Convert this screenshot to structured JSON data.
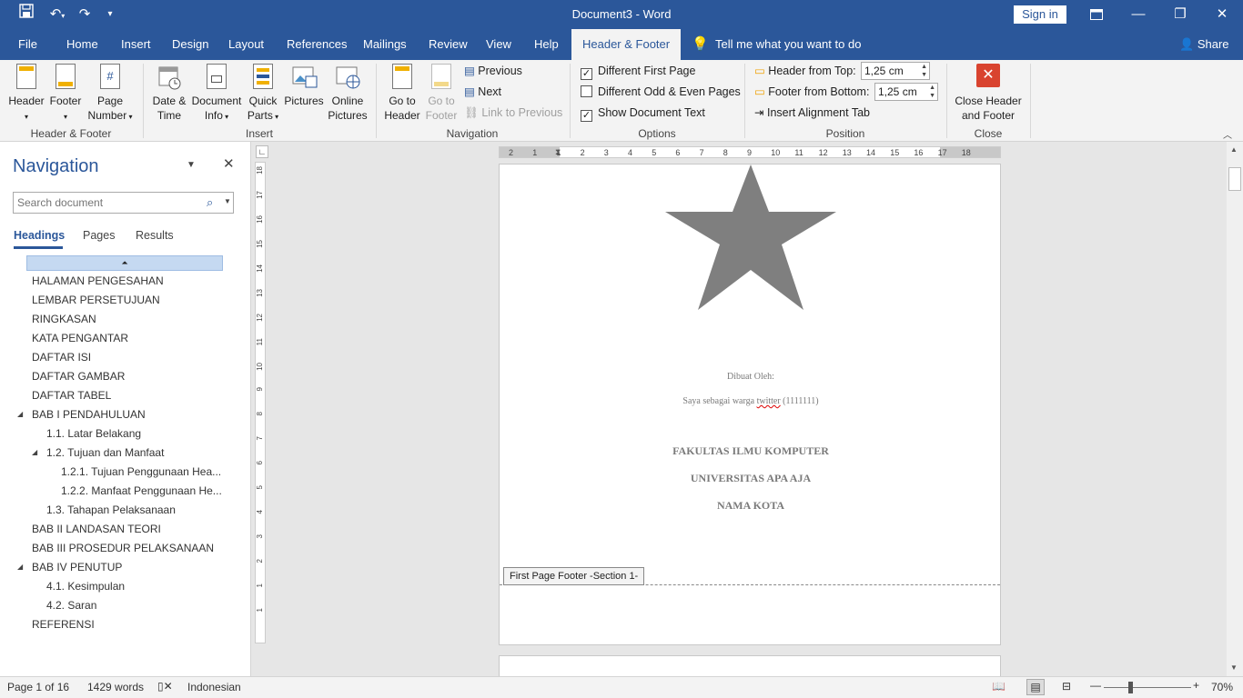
{
  "title": "Document3  -  Word",
  "sign_in": "Sign in",
  "tabs": [
    "File",
    "Home",
    "Insert",
    "Design",
    "Layout",
    "References",
    "Mailings",
    "Review",
    "View",
    "Help",
    "Header & Footer"
  ],
  "tell_me": "Tell me what you want to do",
  "share": "Share",
  "ribbon": {
    "header": "Header",
    "footer": "Footer",
    "page_number": [
      "Page",
      "Number"
    ],
    "hf_group": "Header & Footer",
    "date_time": [
      "Date &",
      "Time"
    ],
    "doc_info": [
      "Document",
      "Info"
    ],
    "quick_parts": [
      "Quick",
      "Parts"
    ],
    "pictures": "Pictures",
    "online_pictures": [
      "Online",
      "Pictures"
    ],
    "insert_group": "Insert",
    "go_header": [
      "Go to",
      "Header"
    ],
    "go_footer": [
      "Go to",
      "Footer"
    ],
    "previous": "Previous",
    "next": "Next",
    "link_prev": "Link to Previous",
    "nav_group": "Navigation",
    "diff_first": "Different First Page",
    "diff_odd": "Different Odd & Even Pages",
    "show_text": "Show Document Text",
    "options_group": "Options",
    "header_top": "Header from Top:",
    "header_top_val": "1,25 cm",
    "footer_bottom": "Footer from Bottom:",
    "footer_bottom_val": "1,25 cm",
    "align_tab": "Insert Alignment Tab",
    "position_group": "Position",
    "close_hf": [
      "Close Header",
      "and Footer"
    ],
    "close_group": "Close"
  },
  "nav": {
    "title": "Navigation",
    "search_placeholder": "Search document",
    "tabs": [
      "Headings",
      "Pages",
      "Results"
    ],
    "items": [
      {
        "t": "HALAMAN PENGESAHAN",
        "lvl": 0
      },
      {
        "t": "LEMBAR PERSETUJUAN",
        "lvl": 0
      },
      {
        "t": "RINGKASAN",
        "lvl": 0
      },
      {
        "t": "KATA PENGANTAR",
        "lvl": 0
      },
      {
        "t": "DAFTAR ISI",
        "lvl": 0
      },
      {
        "t": "DAFTAR GAMBAR",
        "lvl": 0
      },
      {
        "t": "DAFTAR TABEL",
        "lvl": 0
      },
      {
        "t": "BAB I PENDAHULUAN",
        "lvl": 0,
        "exp": true
      },
      {
        "t": "1.1. Latar Belakang",
        "lvl": 1
      },
      {
        "t": "1.2.  Tujuan dan Manfaat",
        "lvl": 1,
        "exp": true
      },
      {
        "t": "1.2.1. Tujuan Penggunaan Hea...",
        "lvl": 2
      },
      {
        "t": "1.2.2. Manfaat Penggunaan He...",
        "lvl": 2
      },
      {
        "t": "1.3. Tahapan Pelaksanaan",
        "lvl": 1
      },
      {
        "t": "BAB II LANDASAN TEORI",
        "lvl": 0
      },
      {
        "t": "BAB III PROSEDUR PELAKSANAAN",
        "lvl": 0
      },
      {
        "t": "BAB IV  PENUTUP",
        "lvl": 0,
        "exp": true
      },
      {
        "t": "4.1. Kesimpulan",
        "lvl": 1
      },
      {
        "t": "4.2. Saran",
        "lvl": 1
      },
      {
        "t": "REFERENSI",
        "lvl": 0
      }
    ]
  },
  "page": {
    "dibuat": "Dibuat Oleh:",
    "author": "Saya sebagai warga twitter (1111111)",
    "fak": "FAKULTAS ILMU KOMPUTER",
    "univ": "UNIVERSITAS APA AJA",
    "kota": "NAMA KOTA",
    "footer_tag": "First Page Footer -Section 1-"
  },
  "hruler_nums": [
    "2",
    "1",
    "1",
    "2",
    "3",
    "4",
    "5",
    "6",
    "7",
    "8",
    "9",
    "10",
    "11",
    "12",
    "13",
    "14",
    "15",
    "16",
    "17",
    "18"
  ],
  "vruler_nums": [
    "18",
    "17",
    "16",
    "15",
    "14",
    "13",
    "12",
    "11",
    "10",
    "9",
    "8",
    "7",
    "6",
    "5",
    "4",
    "3",
    "2",
    "1",
    "1"
  ],
  "status": {
    "page": "Page 1 of 16",
    "words": "1429 words",
    "lang": "Indonesian",
    "zoom": "70%"
  },
  "colors": {
    "brand": "#2b579a",
    "close": "#d9432f"
  }
}
